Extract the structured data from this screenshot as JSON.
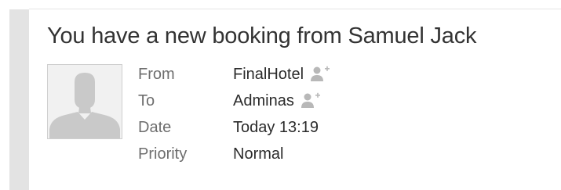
{
  "message": {
    "subject": "You have a new booking from Samuel Jack",
    "avatar_icon": "user-silhouette-icon",
    "fields": {
      "from": {
        "label": "From",
        "value": "FinalHotel",
        "icon": "add-contact-icon"
      },
      "to": {
        "label": "To",
        "value": "Adminas",
        "icon": "add-contact-icon"
      },
      "date": {
        "label": "Date",
        "value": "Today 13:19"
      },
      "priority": {
        "label": "Priority",
        "value": "Normal"
      }
    }
  },
  "colors": {
    "sidebar": "#e3e3e3",
    "label": "#6e6e6e",
    "value": "#2b2b2b",
    "icon": "#b8b8b8"
  }
}
